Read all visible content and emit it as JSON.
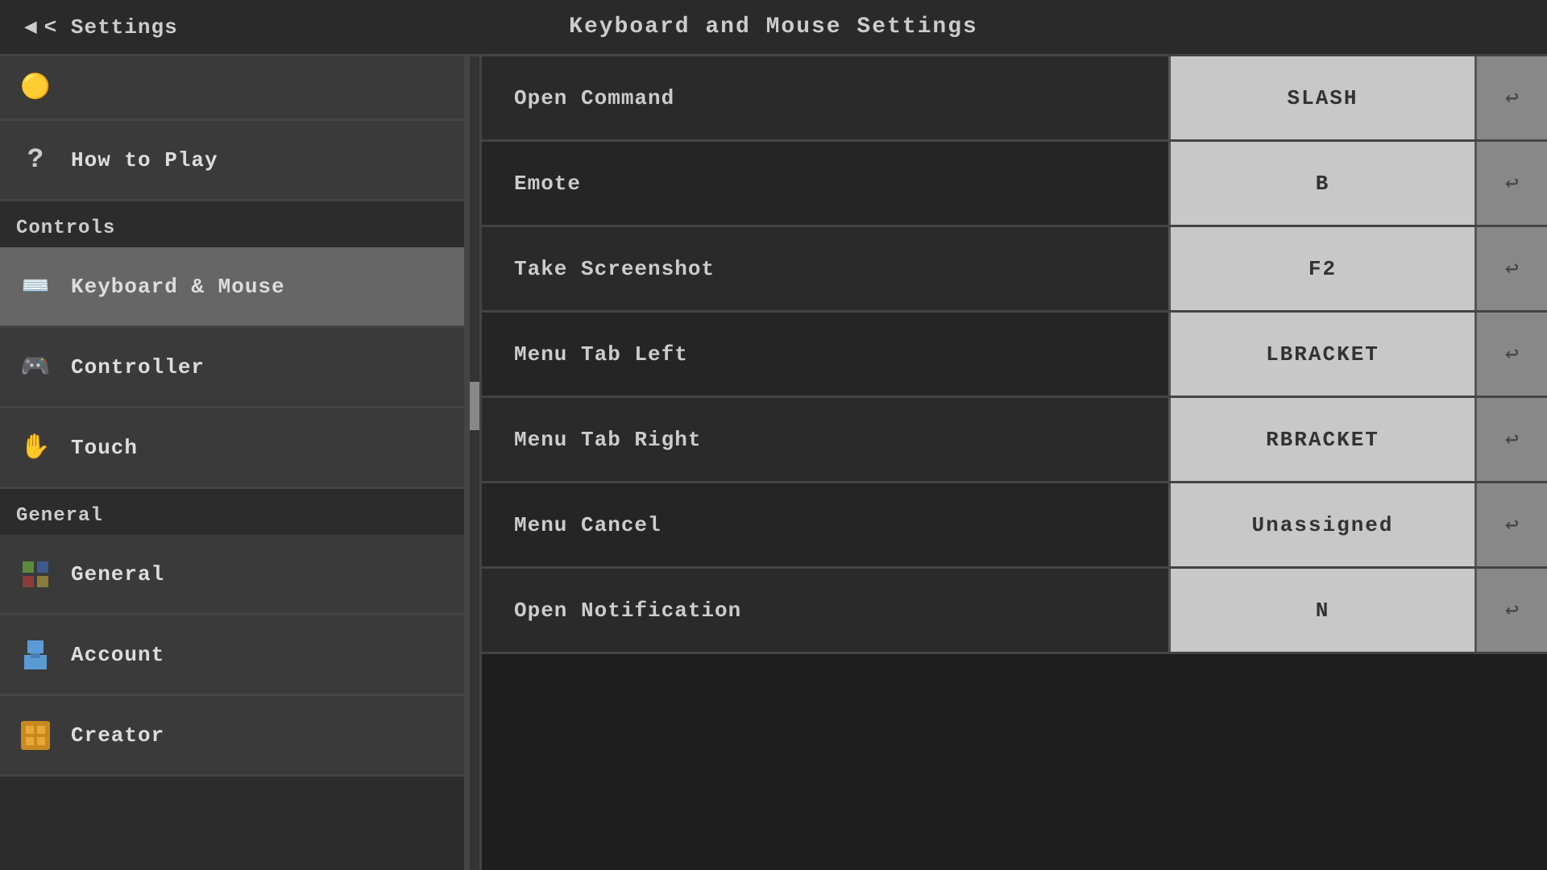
{
  "header": {
    "back_label": "< Settings",
    "title": "Keyboard and Mouse Settings"
  },
  "sidebar": {
    "top_icon": "🟡",
    "sections": [
      {
        "label": "Controls",
        "items": [
          {
            "id": "keyboard-mouse",
            "label": "Keyboard & Mouse",
            "icon": "⌨",
            "active": true
          },
          {
            "id": "controller",
            "label": "Controller",
            "icon": "🎮",
            "active": false
          },
          {
            "id": "touch",
            "label": "Touch",
            "icon": "✋",
            "active": false
          }
        ]
      },
      {
        "label": "General",
        "items": [
          {
            "id": "general",
            "label": "General",
            "icon": "🟢",
            "active": false
          },
          {
            "id": "account",
            "label": "Account",
            "icon": "🟦",
            "active": false
          },
          {
            "id": "creator",
            "label": "Creator",
            "icon": "🟧",
            "active": false
          }
        ]
      }
    ]
  },
  "settings_rows": [
    {
      "label": "Open Command",
      "value": "SLASH"
    },
    {
      "label": "Emote",
      "value": "B"
    },
    {
      "label": "Take Screenshot",
      "value": "F2"
    },
    {
      "label": "Menu Tab Left",
      "value": "LBRACKET"
    },
    {
      "label": "Menu Tab Right",
      "value": "RBRACKET"
    },
    {
      "label": "Menu Cancel",
      "value": "Unassigned"
    },
    {
      "label": "Open Notification",
      "value": "N"
    }
  ],
  "icons": {
    "back_arrow": "◀",
    "reset_arrow": "↩"
  }
}
